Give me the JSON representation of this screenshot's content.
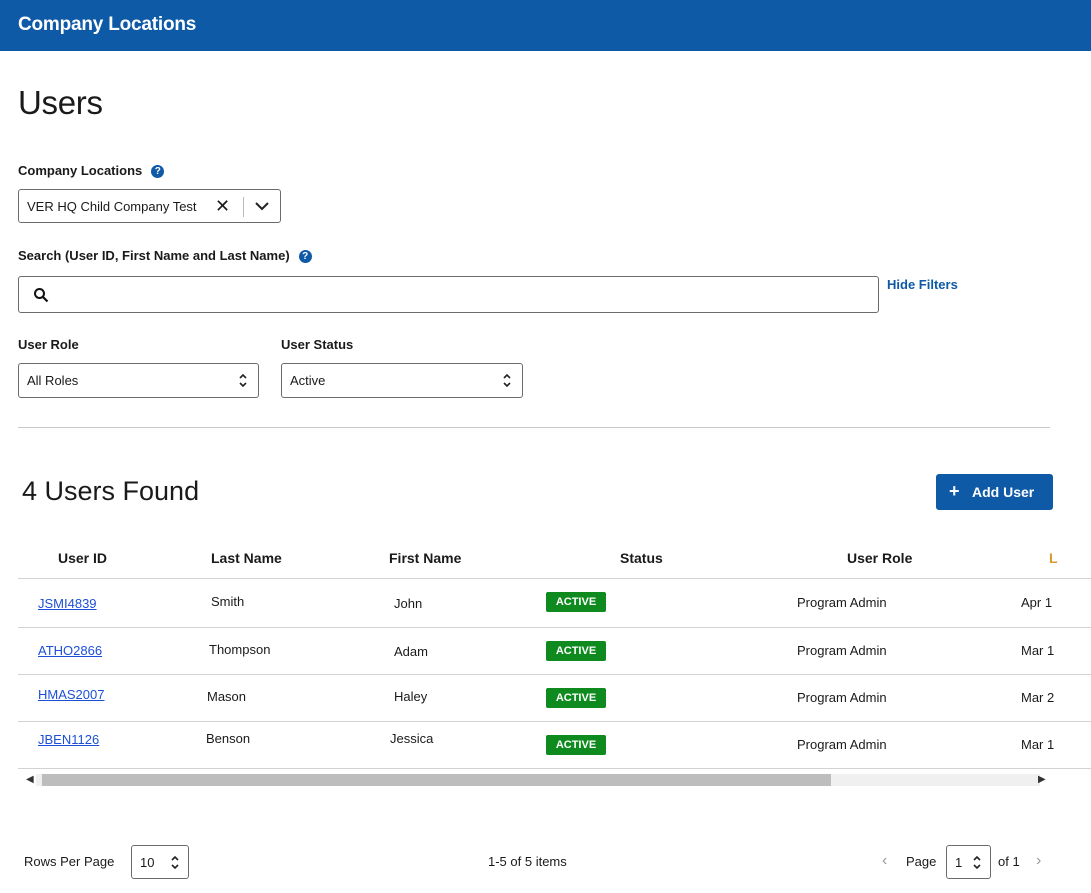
{
  "header": {
    "title": "Company Locations"
  },
  "page": {
    "title": "Users"
  },
  "filters": {
    "locations_label": "Company Locations",
    "locations_value": "VER HQ Child Company Test",
    "search_label": "Search (User ID, First Name and Last Name)",
    "search_value": "",
    "hide_filters": "Hide Filters",
    "role_label": "User Role",
    "role_value": "All Roles",
    "status_label": "User Status",
    "status_value": "Active"
  },
  "results": {
    "count_text": "4 Users Found",
    "add_user": "Add User",
    "columns": [
      "User ID",
      "Last Name",
      "First Name",
      "Status",
      "User Role",
      "L"
    ],
    "rows": [
      {
        "user_id": "JSMI4839",
        "last": "Smith",
        "first": "John",
        "status": "ACTIVE",
        "role": "Program Admin",
        "date": "Apr 1"
      },
      {
        "user_id": "ATHO2866",
        "last": "Thompson",
        "first": "Adam",
        "status": "ACTIVE",
        "role": "Program Admin",
        "date": "Mar 1"
      },
      {
        "user_id": "HMAS2007",
        "last": "Mason",
        "first": "Haley",
        "status": "ACTIVE",
        "role": "Program Admin",
        "date": "Mar 2"
      },
      {
        "user_id": "JBEN1126",
        "last": "Benson",
        "first": "Jessica",
        "status": "ACTIVE",
        "role": "Program Admin",
        "date": "Mar 1"
      }
    ]
  },
  "pagination": {
    "rows_per_page_label": "Rows Per Page",
    "rows_per_page": "10",
    "items_text": "1-5 of 5 items",
    "page_label": "Page",
    "page_value": "1",
    "of_text": "of 1"
  },
  "colors": {
    "brand": "#0e5aa7",
    "active_badge": "#0f8a1f",
    "link": "#1d4fd6"
  }
}
